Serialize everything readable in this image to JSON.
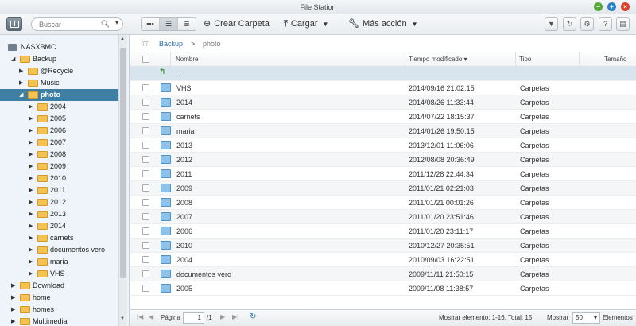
{
  "window": {
    "title": "File Station",
    "controls": [
      "minimize",
      "maximize",
      "close"
    ]
  },
  "toolbar": {
    "search_placeholder": "Buscar",
    "create_folder": "Crear Carpeta",
    "upload": "Cargar",
    "more_actions": "Más acción",
    "icons": [
      "panel-toggle-icon",
      "search-icon",
      "thumbnail-view-icon",
      "list-view-icon",
      "detail-view-icon",
      "plus-icon",
      "upload-icon",
      "wrench-icon",
      "filter-icon",
      "refresh-icon",
      "gear-icon",
      "help-icon",
      "info-icon"
    ]
  },
  "sidebar": {
    "root": "NASXBMC",
    "items": [
      {
        "label": "Backup",
        "level": 1,
        "expanded": true
      },
      {
        "label": "@Recycle",
        "level": 2,
        "expanded": false
      },
      {
        "label": "Music",
        "level": 2,
        "expanded": false
      },
      {
        "label": "photo",
        "level": 2,
        "expanded": true,
        "selected": true
      },
      {
        "label": "2004",
        "level": 3
      },
      {
        "label": "2005",
        "level": 3
      },
      {
        "label": "2006",
        "level": 3
      },
      {
        "label": "2007",
        "level": 3
      },
      {
        "label": "2008",
        "level": 3
      },
      {
        "label": "2009",
        "level": 3
      },
      {
        "label": "2010",
        "level": 3
      },
      {
        "label": "2011",
        "level": 3
      },
      {
        "label": "2012",
        "level": 3
      },
      {
        "label": "2013",
        "level": 3
      },
      {
        "label": "2014",
        "level": 3
      },
      {
        "label": "carnets",
        "level": 3
      },
      {
        "label": "documentos vero",
        "level": 3
      },
      {
        "label": "maria",
        "level": 3
      },
      {
        "label": "VHS",
        "level": 3
      },
      {
        "label": "Download",
        "level": 1
      },
      {
        "label": "home",
        "level": 1
      },
      {
        "label": "homes",
        "level": 1
      },
      {
        "label": "Multimedia",
        "level": 1
      }
    ]
  },
  "breadcrumb": {
    "parent": "Backup",
    "separator": ">",
    "current": "photo"
  },
  "table": {
    "columns": {
      "name": "Nombre",
      "modified": "Tiempo modificado",
      "type": "Tipo",
      "size": "Tamaño"
    },
    "up_label": "..",
    "rows": [
      {
        "name": "VHS",
        "modified": "2014/09/16 21:02:15",
        "type": "Carpetas"
      },
      {
        "name": "2014",
        "modified": "2014/08/26 11:33:44",
        "type": "Carpetas"
      },
      {
        "name": "carnets",
        "modified": "2014/07/22 18:15:37",
        "type": "Carpetas"
      },
      {
        "name": "maria",
        "modified": "2014/01/26 19:50:15",
        "type": "Carpetas"
      },
      {
        "name": "2013",
        "modified": "2013/12/01 11:06:06",
        "type": "Carpetas"
      },
      {
        "name": "2012",
        "modified": "2012/08/08 20:36:49",
        "type": "Carpetas"
      },
      {
        "name": "2011",
        "modified": "2011/12/28 22:44:34",
        "type": "Carpetas"
      },
      {
        "name": "2009",
        "modified": "2011/01/21 02:21:03",
        "type": "Carpetas"
      },
      {
        "name": "2008",
        "modified": "2011/01/21 00:01:26",
        "type": "Carpetas"
      },
      {
        "name": "2007",
        "modified": "2011/01/20 23:51:46",
        "type": "Carpetas"
      },
      {
        "name": "2006",
        "modified": "2011/01/20 23:11:17",
        "type": "Carpetas"
      },
      {
        "name": "2010",
        "modified": "2010/12/27 20:35:51",
        "type": "Carpetas"
      },
      {
        "name": "2004",
        "modified": "2010/09/03 16:22:51",
        "type": "Carpetas"
      },
      {
        "name": "documentos vero",
        "modified": "2009/11/11 21:50:15",
        "type": "Carpetas"
      },
      {
        "name": "2005",
        "modified": "2009/11/08 11:38:57",
        "type": "Carpetas"
      }
    ]
  },
  "footer": {
    "page_label": "Página",
    "page_value": "1",
    "page_total": "/1",
    "status": "Mostrar elemento: 1-16, Total: 15",
    "show_label": "Mostrar",
    "page_size": "50",
    "items_label": "Elementos"
  },
  "colors": {
    "selected": "#3f7fa3",
    "folder": "#f3c250",
    "link": "#2a6fb0",
    "sidebar_bg": "#eef4f9"
  }
}
